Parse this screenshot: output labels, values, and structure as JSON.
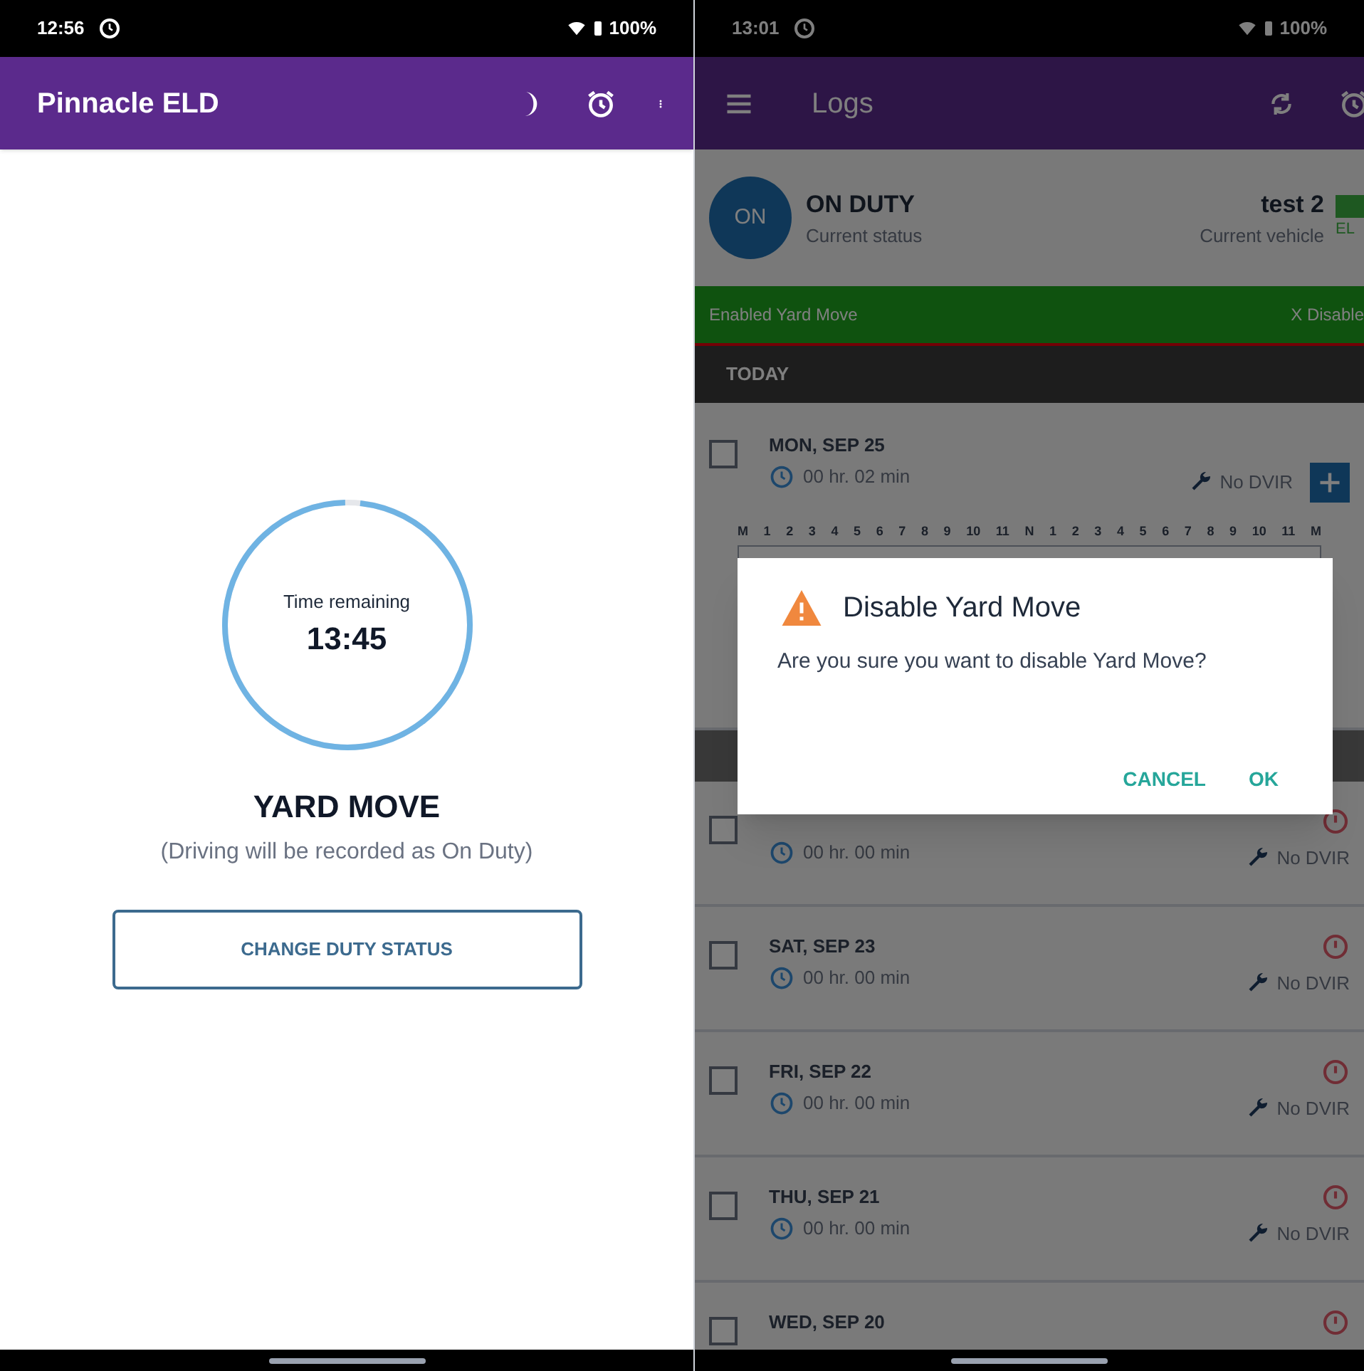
{
  "left": {
    "status_bar": {
      "time": "12:56",
      "battery": "100%"
    },
    "app_bar": {
      "title": "Pinnacle ELD"
    },
    "timer": {
      "label": "Time remaining",
      "value": "13:45",
      "level": 0.98
    },
    "status_title": "YARD MOVE",
    "status_note": "(Driving will be recorded as On Duty)",
    "button": "CHANGE DUTY STATUS"
  },
  "right": {
    "status_bar": {
      "time": "13:01",
      "battery": "100%"
    },
    "app_bar": {
      "title": "Logs"
    },
    "current": {
      "badge": "ON",
      "status": "ON DUTY",
      "status_caption": "Current status",
      "vehicle": "test 2",
      "vehicle_caption": "Current vehicle",
      "eld": "EL"
    },
    "banner": {
      "text": "Enabled Yard Move",
      "action": "X Disable"
    },
    "section": "TODAY",
    "hours": [
      "M",
      "1",
      "2",
      "3",
      "4",
      "5",
      "6",
      "7",
      "8",
      "9",
      "10",
      "11",
      "N",
      "1",
      "2",
      "3",
      "4",
      "5",
      "6",
      "7",
      "8",
      "9",
      "10",
      "11",
      "M"
    ],
    "logs": [
      {
        "kind": "today",
        "date": "MON, SEP 25",
        "duration": "00 hr. 02 min",
        "dvir": "No DVIR",
        "checked": false
      },
      {
        "kind": "past",
        "duration": "00 hr. 00 min",
        "dvir": "No DVIR",
        "checked": false
      },
      {
        "kind": "past",
        "date": "SAT, SEP 23",
        "duration": "00 hr. 00 min",
        "dvir": "No DVIR",
        "checked": false
      },
      {
        "kind": "past",
        "date": "FRI, SEP 22",
        "duration": "00 hr. 00 min",
        "dvir": "No DVIR",
        "checked": false
      },
      {
        "kind": "past",
        "date": "THU, SEP 21",
        "duration": "00 hr. 00 min",
        "dvir": "No DVIR",
        "checked": false
      },
      {
        "kind": "past",
        "date": "WED, SEP 20",
        "checked": false
      }
    ],
    "dialog": {
      "title": "Disable Yard Move",
      "message": "Are you sure you want to disable Yard Move?",
      "buttons": [
        "CANCEL",
        "OK"
      ]
    }
  }
}
